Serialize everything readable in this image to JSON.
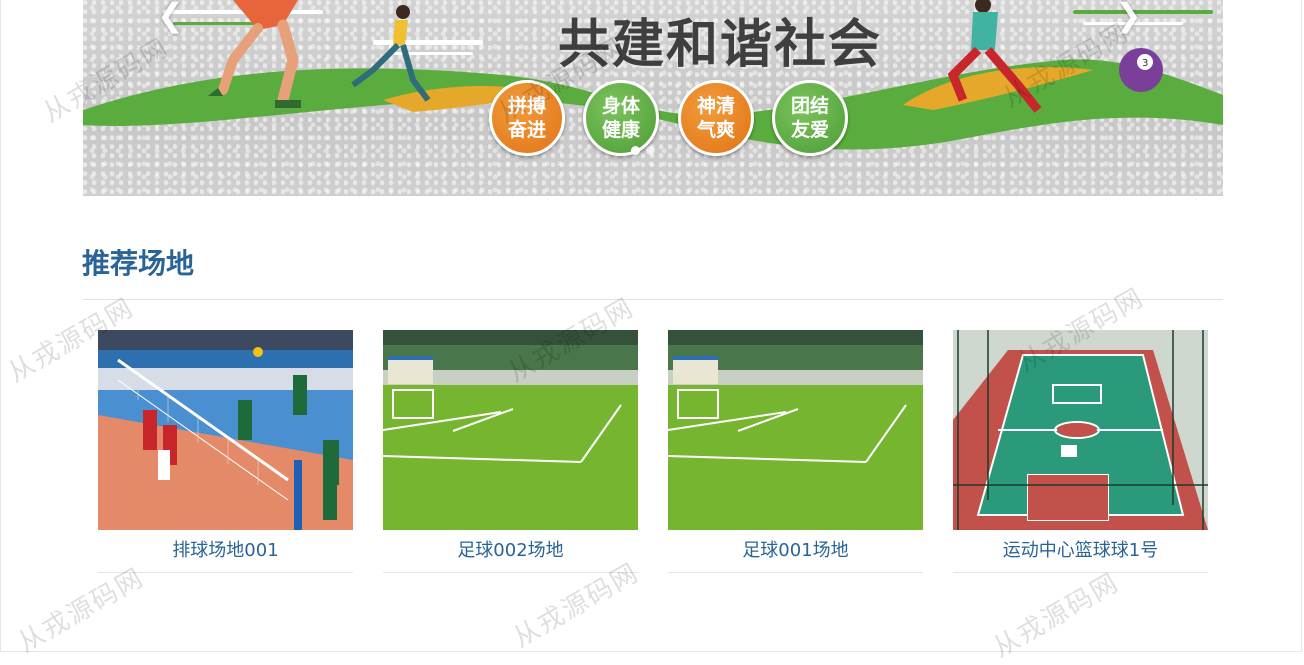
{
  "banner": {
    "title": "共建和谐社会",
    "prev_icon": "chevron-left-icon",
    "next_icon": "chevron-right-icon",
    "prev_symbol": "❮",
    "next_symbol": "❯",
    "badges": [
      {
        "line1": "拼搏",
        "line2": "奋进",
        "color": "orange"
      },
      {
        "line1": "身体",
        "line2": "健康",
        "color": "green"
      },
      {
        "line1": "神清",
        "line2": "气爽",
        "color": "orange"
      },
      {
        "line1": "团结",
        "line2": "友爱",
        "color": "green"
      }
    ],
    "slide_count": 2,
    "active_slide": 1,
    "colors": {
      "green": "#5aac3e",
      "orange": "#e98a23",
      "gold": "#e6a82a",
      "red": "#c9262b",
      "purple": "#7a3f98"
    }
  },
  "recommended": {
    "title": "推荐场地",
    "venues": [
      {
        "name": "排球场地001",
        "image": "volleyball-match-photo"
      },
      {
        "name": "足球002场地",
        "image": "soccer-field-photo"
      },
      {
        "name": "足球001场地",
        "image": "soccer-field-photo"
      },
      {
        "name": "运动中心篮球球1号",
        "image": "basketball-court-photo"
      }
    ]
  },
  "watermark": "从戎源码网",
  "colors": {
    "heading": "#2a6496",
    "link": "#2a6496",
    "divider": "#e3e3e3"
  }
}
